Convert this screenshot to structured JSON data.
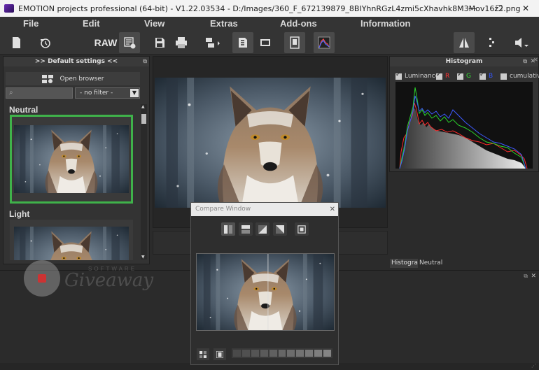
{
  "window": {
    "title": "EMOTION projects professional (64-bit) - V1.22.03534 - D:/Images/360_F_672139879_8BIYhnRGzL4zmi5cXhavhk8M3Mov16z2.png",
    "controls": [
      "—",
      "☐",
      "✕"
    ]
  },
  "menu": [
    "File",
    "Edit",
    "View",
    "Extras",
    "Add-ons",
    "Information"
  ],
  "toolbar": {
    "raw_label": "RAW",
    "buttons": [
      "new-document",
      "history",
      "raw",
      "settings",
      "save",
      "print",
      "export",
      "presets",
      "crop",
      "info",
      "histogram",
      "split",
      "dots",
      "dropdown"
    ]
  },
  "left_panel": {
    "header": ">> Default settings <<",
    "open_browser": "Open browser",
    "search_placeholder": "",
    "filter_value": "- no filter -",
    "presets": [
      "Neutral",
      "Light"
    ],
    "selected_preset": "Neutral"
  },
  "histogram": {
    "header": "Histogram",
    "channels": [
      {
        "label": "Luminance",
        "checked": true,
        "color": "#cccccc"
      },
      {
        "label": "R",
        "checked": true,
        "color": "#ff3333"
      },
      {
        "label": "G",
        "checked": true,
        "color": "#33dd33"
      },
      {
        "label": "B",
        "checked": true,
        "color": "#3355ff"
      },
      {
        "label": "cumulative",
        "checked": false,
        "color": "#cccccc"
      }
    ],
    "tabs": [
      "Histogram",
      "Neutral"
    ]
  },
  "compare": {
    "title": "Compare Window",
    "close": "✕"
  },
  "watermark": {
    "top": "SOFTWARE",
    "main": "Giveaway"
  },
  "colors": {
    "accent_selected": "#3fb24a",
    "panel_bg": "#333333",
    "app_bg": "#2b2b2b"
  }
}
